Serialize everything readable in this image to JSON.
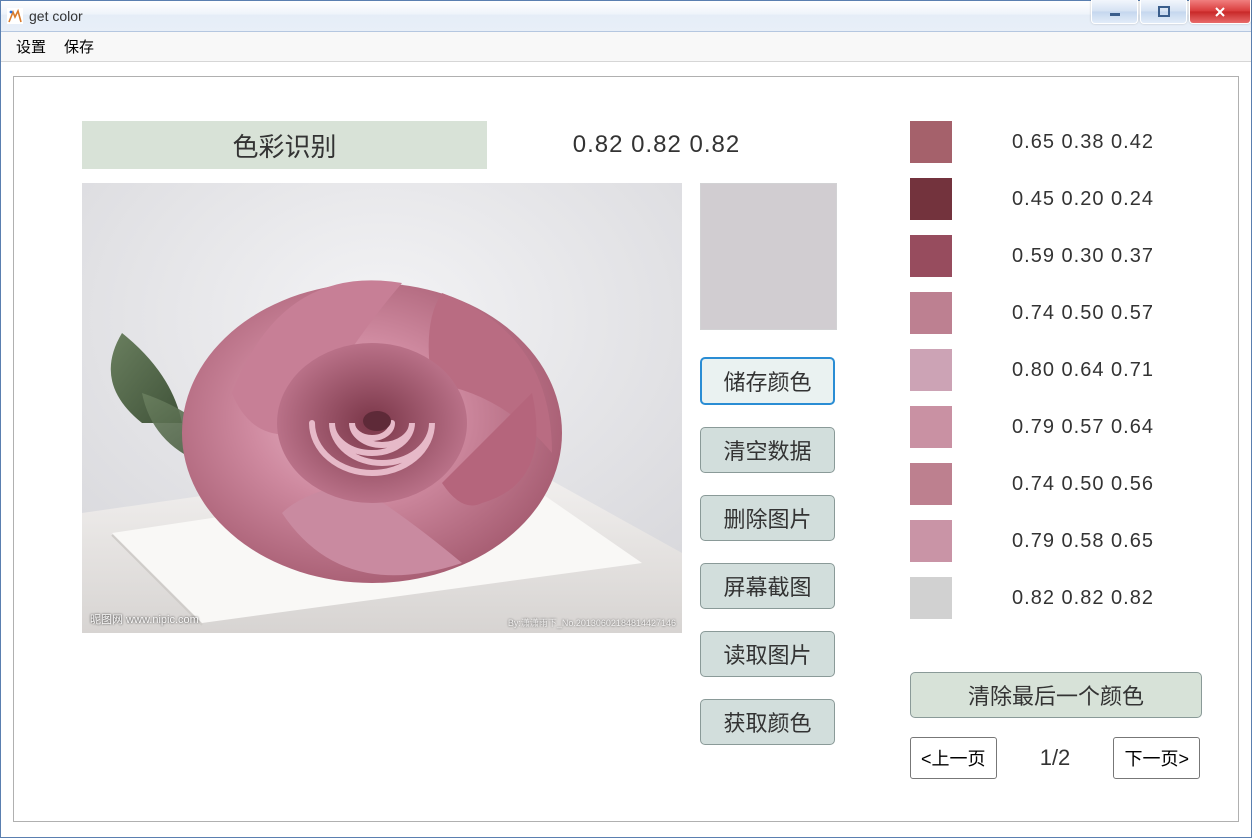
{
  "window": {
    "title": "get color"
  },
  "menu": {
    "settings": "设置",
    "save": "保存"
  },
  "main": {
    "panel_title": "色彩识别",
    "current_rgb": "0.82  0.82  0.82",
    "current_swatch_color": "#d1cdd1",
    "watermark_left": "昵图网 www.nipic.com",
    "watermark_right": "By:潇潇雨下_No.20130602184814427146"
  },
  "actions": {
    "store_color": "储存颜色",
    "clear_data": "清空数据",
    "delete_image": "删除图片",
    "screenshot": "屏幕截图",
    "load_image": "读取图片",
    "get_color": "获取颜色"
  },
  "palette": [
    {
      "hex": "#a5616b",
      "label": "0.65  0.38  0.42"
    },
    {
      "hex": "#73333d",
      "label": "0.45  0.20  0.24"
    },
    {
      "hex": "#974c5e",
      "label": "0.59  0.30  0.37"
    },
    {
      "hex": "#bd8091",
      "label": "0.74  0.50  0.57"
    },
    {
      "hex": "#cca3b5",
      "label": "0.80  0.64  0.71"
    },
    {
      "hex": "#c991a3",
      "label": "0.79  0.57  0.64"
    },
    {
      "hex": "#bd808f",
      "label": "0.74  0.50  0.56"
    },
    {
      "hex": "#c994a6",
      "label": "0.79  0.58  0.65"
    },
    {
      "hex": "#d1d1d1",
      "label": "0.82  0.82  0.82"
    }
  ],
  "clear_last": "清除最后一个颜色",
  "pager": {
    "prev": "<上一页",
    "indicator": "1/2",
    "next": "下一页>"
  }
}
